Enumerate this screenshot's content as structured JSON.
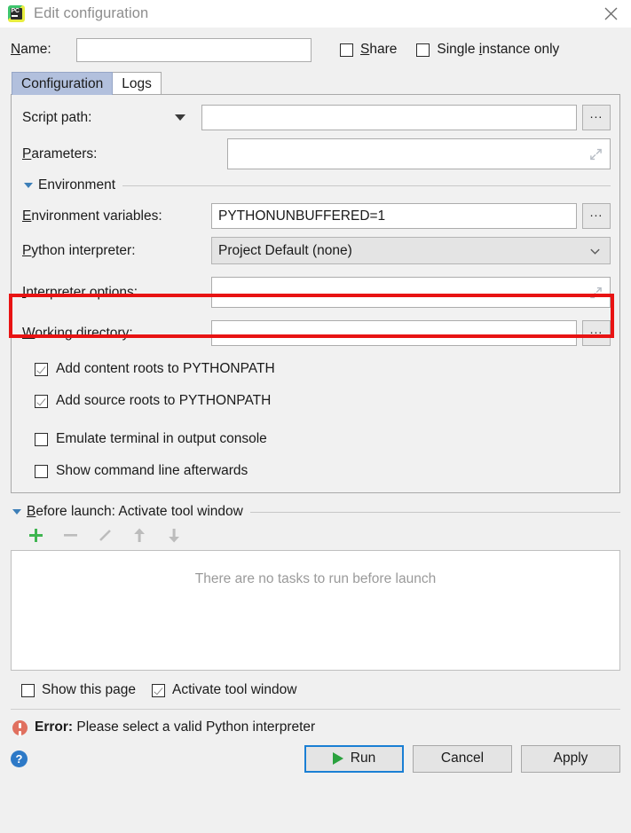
{
  "window": {
    "title": "Edit configuration",
    "app_icon": "pycharm-icon",
    "icon_text": "PC",
    "close_icon": "close-icon"
  },
  "header": {
    "name_label": "Name:",
    "name_mnemonic": "N",
    "name_value": "",
    "name_placeholder": "",
    "share_label": "Share",
    "share_mnemonic": "S",
    "share_checked": false,
    "single_instance_label_pre": "Single ",
    "single_instance_mnemonic": "i",
    "single_instance_label_post": "nstance only",
    "single_instance_checked": false
  },
  "tabs": [
    {
      "label": "Configuration",
      "active": true
    },
    {
      "label": "Logs",
      "active": false
    }
  ],
  "configuration": {
    "script_path": {
      "label": "Script path:",
      "value": "",
      "dropdown_icon": "triangle-down-icon",
      "browse_label": "...",
      "browse_icon": "ellipsis-icon"
    },
    "parameters": {
      "label_pre": "",
      "label_mnemonic": "P",
      "label_post": "arameters:",
      "label": "Parameters:",
      "value": "",
      "expand_icon": "expand-diagonal-icon"
    },
    "environment_section": {
      "title": "Environment",
      "expanded": true,
      "collapse_icon": "triangle-down-icon"
    },
    "environment_variables": {
      "label": "Environment variables:",
      "label_mnemonic": "E",
      "value": "PYTHONUNBUFFERED=1",
      "browse_label": "...",
      "browse_icon": "ellipsis-icon"
    },
    "python_interpreter": {
      "label": "Python interpreter:",
      "label_mnemonic": "P",
      "value": "Project Default (none)",
      "chevron_icon": "chevron-down-icon",
      "options": [
        "Project Default (none)"
      ]
    },
    "interpreter_options": {
      "label": "Interpreter options:",
      "label_mnemonic": "I",
      "value": "",
      "expand_icon": "expand-diagonal-icon",
      "highlighted": true,
      "highlight_color": "#e81313"
    },
    "working_directory": {
      "label": "Working directory:",
      "label_mnemonic": "W",
      "value": "",
      "browse_label": "...",
      "browse_icon": "ellipsis-icon"
    },
    "checkboxes": [
      {
        "label": "Add content roots to PYTHONPATH",
        "checked": true
      },
      {
        "label": "Add source roots to PYTHONPATH",
        "checked": true
      },
      {
        "label": "Emulate terminal in output console",
        "checked": false
      },
      {
        "label": "Show command line afterwards",
        "checked": false
      }
    ]
  },
  "before_launch": {
    "title": "Before launch: Activate tool window",
    "title_mnemonic": "B",
    "expanded": true,
    "collapse_icon": "triangle-down-icon",
    "toolbar": [
      {
        "name": "add-task-button",
        "icon": "plus-icon",
        "enabled": true,
        "color": "#4caf50"
      },
      {
        "name": "remove-task-button",
        "icon": "minus-icon",
        "enabled": false,
        "color": "#b8b8b8"
      },
      {
        "name": "edit-task-button",
        "icon": "pencil-icon",
        "enabled": false,
        "color": "#b8b8b8"
      },
      {
        "name": "move-up-button",
        "icon": "arrow-up-icon",
        "enabled": false,
        "color": "#b8b8b8"
      },
      {
        "name": "move-down-button",
        "icon": "arrow-down-icon",
        "enabled": false,
        "color": "#b8b8b8"
      }
    ],
    "empty_message": "There are no tasks to run before launch"
  },
  "footer": {
    "show_this_page": {
      "label": "Show this page",
      "checked": false
    },
    "activate_tool_window": {
      "label": "Activate tool window",
      "checked": true
    },
    "error": {
      "icon": "error-icon",
      "prefix": "Error:",
      "message": "Please select a valid Python interpreter",
      "color": "#e0705f"
    },
    "help_icon": "help-icon",
    "help_glyph": "?",
    "buttons": [
      {
        "label": "Run",
        "icon": "play-icon",
        "focused": true
      },
      {
        "label": "Cancel",
        "icon": "",
        "focused": false
      },
      {
        "label": "Apply",
        "icon": "",
        "focused": false
      }
    ]
  }
}
